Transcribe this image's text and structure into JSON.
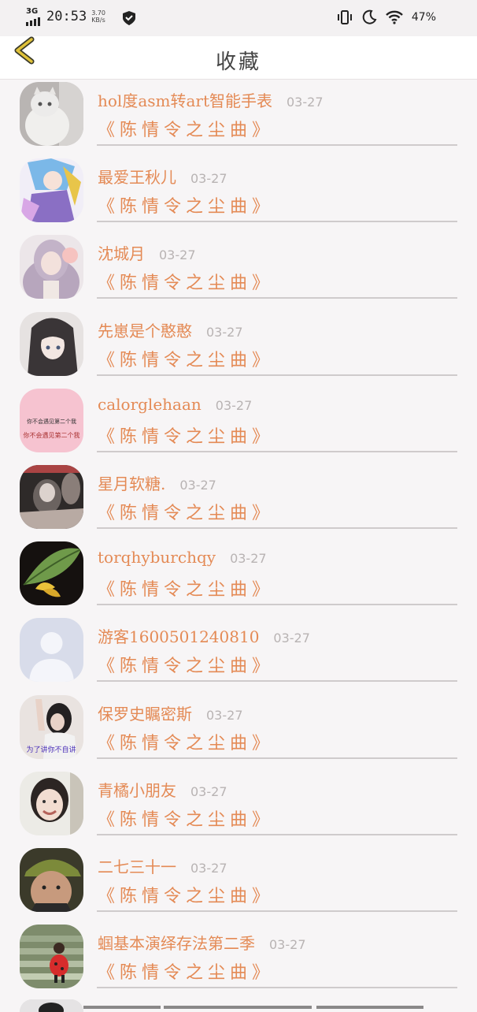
{
  "status": {
    "network": "3G",
    "time": "20:53",
    "speed_value": "3.70",
    "speed_unit": "KB/s",
    "battery": "47%"
  },
  "header": {
    "title": "收藏",
    "back_icon": "chevron-left-icon"
  },
  "colors": {
    "accent": "#e48a55",
    "date": "#b8b3b3",
    "divider": "#cfcbcc",
    "back": "#e0c23a"
  },
  "items": [
    {
      "name": "hol度asm转art智能手表",
      "date": "03-27",
      "song": "《陈情令之尘曲》",
      "avatar_desc": "white-cat"
    },
    {
      "name": "最爱王秋儿",
      "date": "03-27",
      "song": "《陈情令之尘曲》",
      "avatar_desc": "anime-blue-hair"
    },
    {
      "name": "沈城月",
      "date": "03-27",
      "song": "《陈情令之尘曲》",
      "avatar_desc": "girl-lavender-hair"
    },
    {
      "name": "先崽是个憨憨",
      "date": "03-27",
      "song": "《陈情令之尘曲》",
      "avatar_desc": "anime-dark-hair"
    },
    {
      "name": "calorglehaan",
      "date": "03-27",
      "song": "《陈情令之尘曲》",
      "avatar_desc": "pink-text-card",
      "avatar_text": "你不会遇见第二个我"
    },
    {
      "name": "星月软糖.",
      "date": "03-27",
      "song": "《陈情令之尘曲》",
      "avatar_desc": "girl-bw-photo"
    },
    {
      "name": "torqhyburchqy",
      "date": "03-27",
      "song": "《陈情令之尘曲》",
      "avatar_desc": "green-leaf-flower"
    },
    {
      "name": "游客1600501240810",
      "date": "03-27",
      "song": "《陈情令之尘曲》",
      "avatar_desc": "default-user"
    },
    {
      "name": "保罗史瞩密斯",
      "date": "03-27",
      "song": "《陈情令之尘曲》",
      "avatar_desc": "girl-waving",
      "avatar_text": "为了讲你不自讲"
    },
    {
      "name": "青橘小朋友",
      "date": "03-27",
      "song": "《陈情令之尘曲》",
      "avatar_desc": "smiling-girl"
    },
    {
      "name": "二七三十一",
      "date": "03-27",
      "song": "《陈情令之尘曲》",
      "avatar_desc": "boy-cap"
    },
    {
      "name": "蝈基本演绎存法第二季",
      "date": "03-27",
      "song": "《陈情令之尘曲》",
      "avatar_desc": "child-stairs"
    }
  ]
}
